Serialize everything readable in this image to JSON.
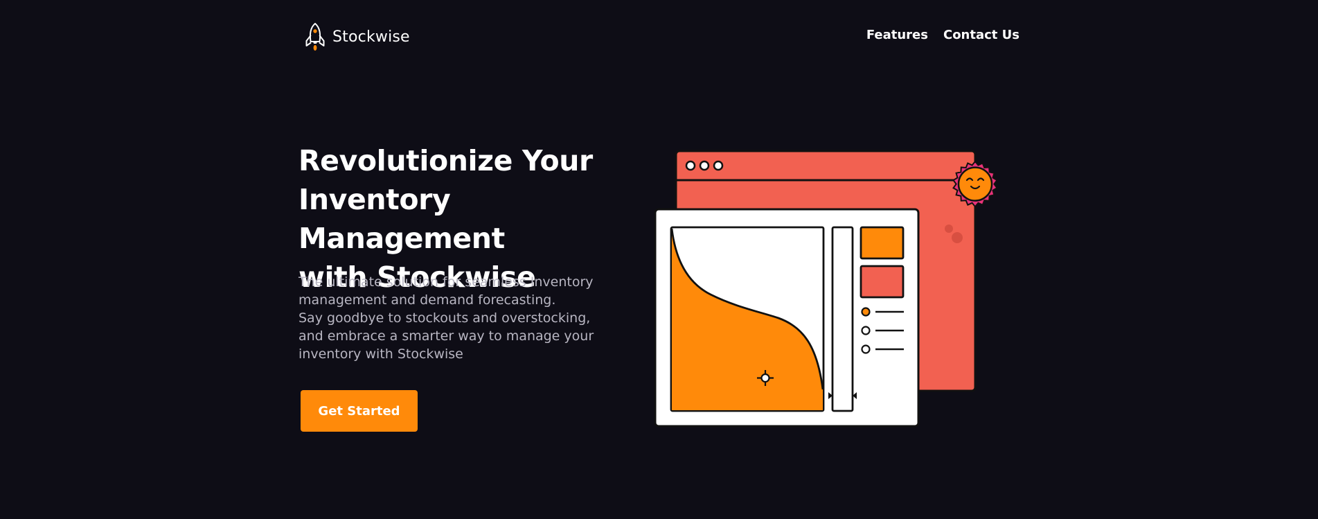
{
  "brand": {
    "name": "Stockwise",
    "logo_icon": "rocket-icon"
  },
  "nav": {
    "links": [
      {
        "label": "Features"
      },
      {
        "label": "Contact Us"
      }
    ]
  },
  "hero": {
    "title_lines": [
      "Revolutionize Your",
      "Inventory Management",
      "with Stockwise"
    ],
    "description": {
      "line1": "The ultimate solution for seamless Inventory management and demand forecasting.",
      "line2": "Say goodbye to stockouts and overstocking, and embrace a smarter way to manage your inventory with Stockwise"
    },
    "cta_label": "Get Started"
  },
  "illustration": {
    "icons": [
      "browser-window-icon",
      "sun-icon",
      "crosshair-icon"
    ]
  },
  "colors": {
    "background": "#0e0d16",
    "accent_orange": "#ff8a0a",
    "coral": "#f26151",
    "pink": "#e8327a",
    "text_white": "#ffffff",
    "text_muted": "#b8b6c2"
  }
}
